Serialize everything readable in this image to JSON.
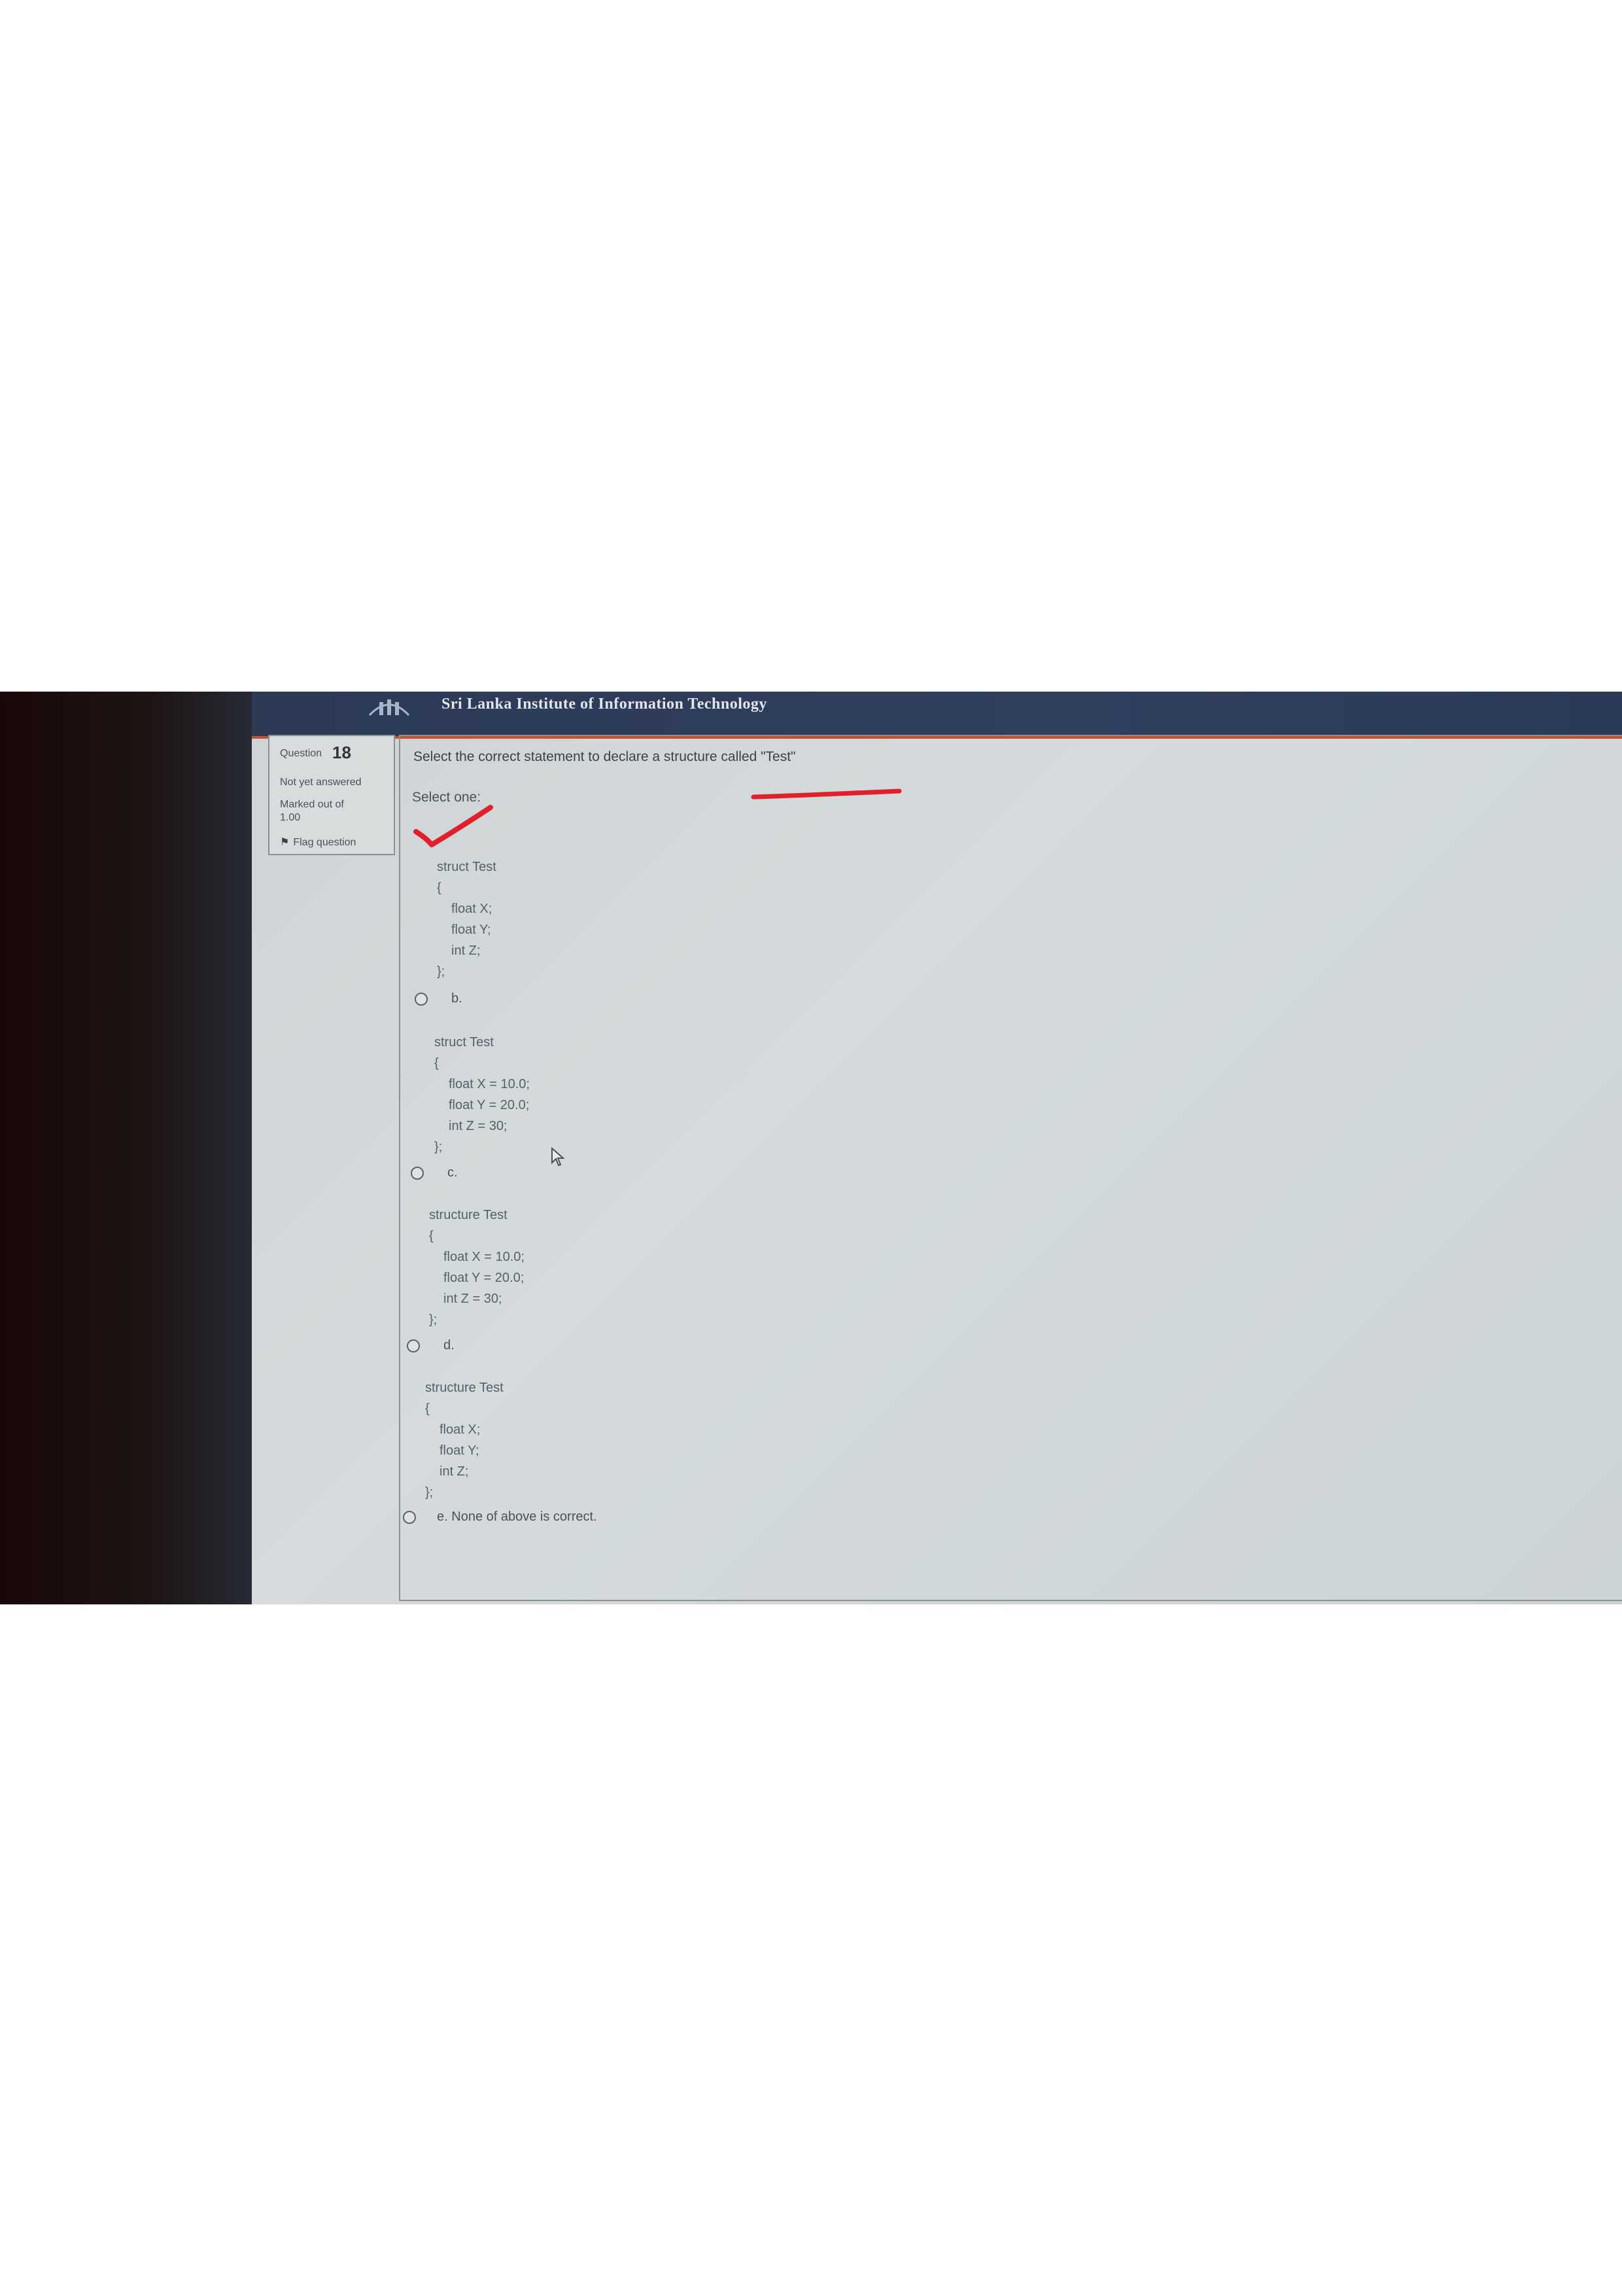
{
  "header": {
    "org_name": "Sri Lanka Institute of Information Technology"
  },
  "info": {
    "question_label": "Question",
    "question_number": "18",
    "state": "Not yet answered",
    "marked_label": "Marked out of",
    "marked_value": "1.00",
    "flag_label": "Flag question"
  },
  "question": {
    "text": "Select the correct statement to declare a structure called \"Test\"",
    "select_one": "Select one:"
  },
  "options": [
    {
      "code": [
        "struct Test",
        "{",
        "float X;",
        "float Y;",
        "int Z;",
        "};"
      ]
    },
    {
      "letter": "b.",
      "code": [
        "struct Test",
        "{",
        "float X = 10.0;",
        "float Y = 20.0;",
        "int Z = 30;",
        "};"
      ]
    },
    {
      "letter": "c.",
      "code": [
        "structure Test",
        "{",
        "float X = 10.0;",
        "float Y = 20.0;",
        "int Z = 30;",
        "};"
      ]
    },
    {
      "letter": "d.",
      "code": [
        "structure Test",
        "{",
        "float X;",
        "float Y;",
        "int Z;",
        "};"
      ]
    },
    {
      "letter": "e.",
      "text": "None of above is correct."
    }
  ],
  "colors": {
    "header": "#2f3f5e",
    "accent": "#c9502d",
    "annotation": "#e0202a"
  }
}
